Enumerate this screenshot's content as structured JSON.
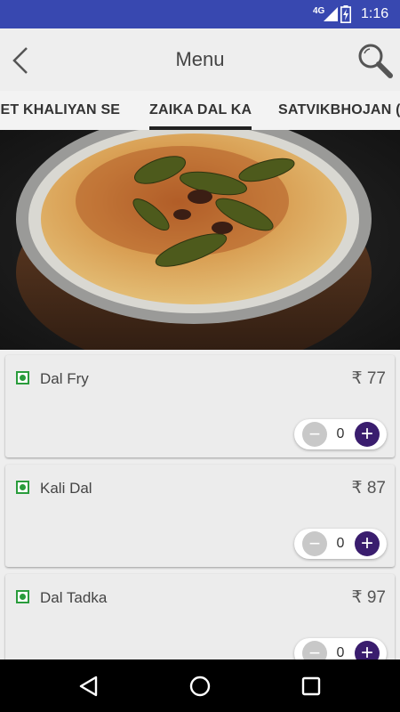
{
  "status_bar": {
    "network": "4G",
    "time": "1:16",
    "icons": [
      "signal-icon",
      "battery-charging-icon"
    ]
  },
  "app_bar": {
    "title": "Menu",
    "icons": [
      "back-arrow-icon",
      "search-icon"
    ]
  },
  "tabs": [
    {
      "label": "KHET KHALIYAN SE",
      "active": false
    },
    {
      "label": "ZAIKA DAL KA",
      "active": true
    },
    {
      "label": "SATVIKBHOJAN (",
      "active": false
    }
  ],
  "hero": {
    "image": "dal-tadka-bowl-photo"
  },
  "items": [
    {
      "name": "Dal Fry",
      "price": "₹ 77",
      "qty": "0",
      "veg": true
    },
    {
      "name": "Kali Dal",
      "price": "₹ 87",
      "qty": "0",
      "veg": true
    },
    {
      "name": "Dal Tadka",
      "price": "₹ 97",
      "qty": "0",
      "veg": true
    }
  ],
  "stepper": {
    "minus": "−",
    "plus": "+"
  },
  "colors": {
    "status_bar": "#3848b0",
    "veg_green": "#2a9c3c",
    "accent_purple": "#3a1d6e"
  },
  "nav_bar": {
    "icons": [
      "back-triangle-icon",
      "home-circle-icon",
      "recents-square-icon"
    ]
  }
}
